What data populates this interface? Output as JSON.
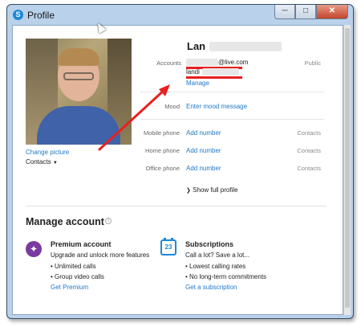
{
  "window": {
    "title": "Profile",
    "app_icon": "S"
  },
  "profile": {
    "name": "Lan",
    "accounts_label": "Accounts",
    "account_1": "@live.com",
    "account_2": "landi",
    "manage_link": "Manage",
    "public_label": "Public",
    "mood_label": "Mood",
    "mood_placeholder": "Enter mood message",
    "change_picture": "Change picture",
    "contacts_dropdown": "Contacts",
    "phones": [
      {
        "label": "Mobile phone",
        "action": "Add number",
        "visibility": "Contacts"
      },
      {
        "label": "Home phone",
        "action": "Add number",
        "visibility": "Contacts"
      },
      {
        "label": "Office phone",
        "action": "Add number",
        "visibility": "Contacts"
      }
    ],
    "show_full_profile": "Show full profile"
  },
  "manage": {
    "title": "Manage account",
    "premium": {
      "title": "Premium account",
      "desc": "Upgrade and unlock more features",
      "bullets": [
        "Unlimited calls",
        "Group video calls"
      ],
      "link": "Get Premium"
    },
    "subscriptions": {
      "title": "Subscriptions",
      "desc": "Call a lot? Save a lot...",
      "bullets": [
        "Lowest calling rates",
        "No long-term commitments"
      ],
      "link": "Get a subscription",
      "icon_number": "23"
    }
  },
  "annotation": {
    "color": "#e82020"
  }
}
